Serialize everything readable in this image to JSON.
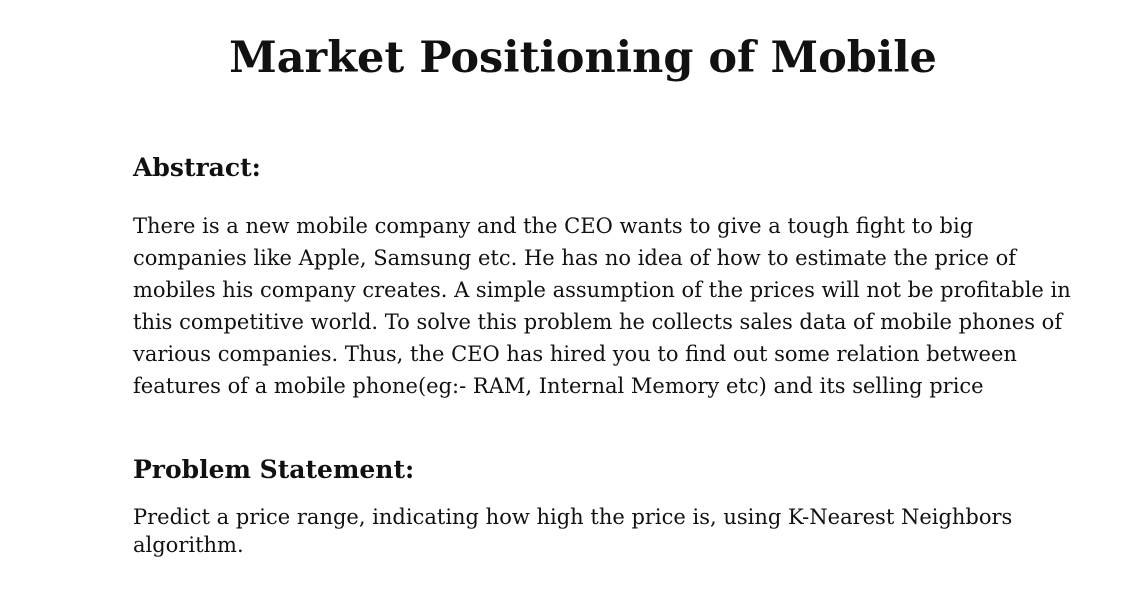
{
  "document": {
    "title": "Market Positioning of Mobile",
    "abstract": {
      "heading": "Abstract:",
      "lines": [
        "There is a new mobile company and the CEO wants to give a tough fight to big",
        "companies like Apple, Samsung etc. He has no idea of how to estimate the price of",
        "mobiles his company creates. A simple assumption of the prices will not be profitable in",
        "this competitive world. To solve this problem he collects sales data of mobile phones of",
        "various companies. Thus, the CEO has hired you to find out some relation between",
        "features of a mobile phone(eg:- RAM, Internal Memory etc) and its selling price"
      ]
    },
    "problem_statement": {
      "heading": "Problem Statement:",
      "lines": [
        "Predict a price range, indicating how high the price is, using K-Nearest Neighbors",
        "algorithm."
      ]
    }
  }
}
